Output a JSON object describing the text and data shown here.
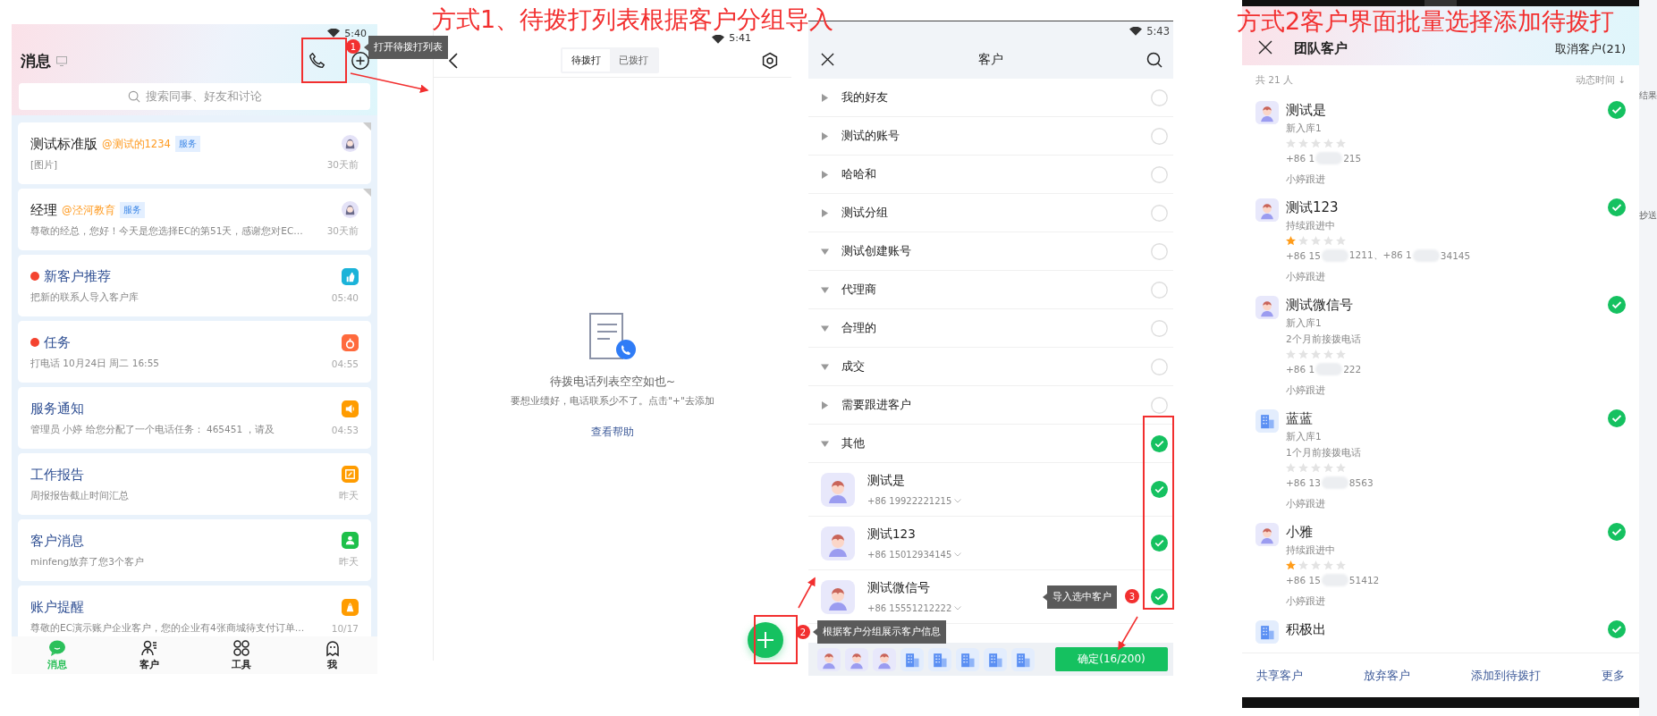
{
  "annotations": {
    "titles": [
      "方式1、待拨打列表根据客户分组导入",
      "方式2客户界面批量选择添加待拨打"
    ],
    "steps": [
      {
        "number": "1",
        "tip": "打开待拨打列表"
      },
      {
        "number": "2",
        "tip": "根据客户分组展示客户信息"
      },
      {
        "number": "3",
        "tip": "导入选中客户"
      }
    ]
  },
  "messages_screen": {
    "status_time": "5:40",
    "title": "消息",
    "search": {
      "placeholder": "搜索同事、好友和讨论"
    },
    "conversations": [
      {
        "kind": "chat",
        "title": "测试标准版",
        "mention": "@测试的1234",
        "tag": "服务",
        "preview": "[图片]",
        "time": "30天前",
        "unread": false,
        "pinned": true
      },
      {
        "kind": "chat",
        "title": "经理",
        "mention": "@泾河教育",
        "tag": "服务",
        "preview": "尊敬的经总，您好！今天是您选择EC的第51天，感谢您对EC…",
        "time": "30天前",
        "unread": false,
        "pinned": true
      },
      {
        "kind": "like",
        "color": "#1bb3d9",
        "title": "新客户推荐",
        "preview": "把新的联系人导入客户库",
        "time": "05:40",
        "unread": true,
        "pinned": false
      },
      {
        "kind": "fire",
        "color": "#ff6a3d",
        "title": "任务",
        "preview": "打电话 10月24日 周二 16:55",
        "time": "04:55",
        "unread": true,
        "pinned": false
      },
      {
        "kind": "speaker",
        "color": "#ff9c00",
        "title": "服务通知",
        "preview": "管理员 小婷 给您分配了一个电话任务：  465451 ，请及",
        "time": "04:53",
        "unread": false,
        "pinned": false
      },
      {
        "kind": "edit",
        "color": "#ff9c00",
        "title": "工作报告",
        "preview": "周报报告截止时间汇总",
        "time": "昨天",
        "unread": false,
        "pinned": false
      },
      {
        "kind": "user",
        "color": "#1ec04a",
        "title": "客户消息",
        "preview": "minfeng放弃了您3个客户",
        "time": "昨天",
        "unread": false,
        "pinned": false
      },
      {
        "kind": "bag",
        "color": "#ff9c00",
        "title": "账户提醒",
        "preview": "尊敬的EC演示账户企业客户，您的企业有4张商城待支付订单…",
        "time": "10/17",
        "unread": false,
        "pinned": false
      }
    ],
    "nav": [
      {
        "kind": "chat",
        "label": "消息",
        "selected": true
      },
      {
        "kind": "contacts",
        "label": "客户",
        "selected": false
      },
      {
        "kind": "apps",
        "label": "工具",
        "selected": false
      },
      {
        "kind": "ghost",
        "label": "我",
        "selected": false
      }
    ]
  },
  "call_list_screen": {
    "status_time": "5:41",
    "tabs": [
      {
        "label": "待拨打",
        "selected": true
      },
      {
        "label": "已拨打",
        "selected": false
      }
    ],
    "empty_title": "待拨电话列表空空如也~",
    "empty_hint": "要想业绩好，电话联系少不了。点击\"+\"去添加",
    "help_link": "查看帮助"
  },
  "customer_picker_screen": {
    "status_time": "5:43",
    "title": "客户",
    "groups": [
      {
        "name": "我的好友",
        "expanded": false,
        "checked": false
      },
      {
        "name": "测试的账号",
        "expanded": false,
        "checked": false
      },
      {
        "name": "哈哈和",
        "expanded": false,
        "checked": false
      },
      {
        "name": "测试分组",
        "expanded": false,
        "checked": false
      },
      {
        "name": "测试创建账号",
        "expanded": true,
        "checked": false
      },
      {
        "name": "代理商",
        "expanded": true,
        "checked": false
      },
      {
        "name": "合理的",
        "expanded": true,
        "checked": false
      },
      {
        "name": "成交",
        "expanded": true,
        "checked": false
      },
      {
        "name": "需要跟进客户",
        "expanded": false,
        "checked": false
      },
      {
        "name": "其他",
        "expanded": true,
        "checked": true,
        "children": [
          {
            "name": "测试是",
            "phone": "+86 19922221215",
            "checked": true
          },
          {
            "name": "测试123",
            "phone": "+86 15012934145",
            "checked": true
          },
          {
            "name": "测试微信号",
            "phone": "+86 15551212222",
            "checked": true
          }
        ]
      }
    ],
    "selected_avatars": [
      {
        "kind": "person"
      },
      {
        "kind": "person"
      },
      {
        "kind": "person"
      },
      {
        "kind": "company"
      },
      {
        "kind": "company"
      },
      {
        "kind": "company"
      },
      {
        "kind": "company"
      },
      {
        "kind": "company"
      }
    ],
    "confirm_button": "确定(16/200)"
  },
  "team_customers_screen": {
    "title": "团队客户",
    "cancel_button": "取消客户(21)",
    "count": "共 21 人",
    "sort_label": "动态时间 ↓",
    "customers": [
      {
        "kind": "person",
        "name": "测试是",
        "status": "新入库1",
        "stars": 0,
        "phone_parts": [
          "+86 1",
          "215"
        ],
        "owner": "小婷跟进",
        "checked": true
      },
      {
        "kind": "person",
        "name": "测试123",
        "status": "持续跟进中",
        "stars": 1,
        "phone_parts": [
          "+86 15",
          "1211、+86 1",
          "34145"
        ],
        "owner": "小婷跟进",
        "checked": true
      },
      {
        "kind": "person",
        "name": "测试微信号",
        "status": "新入库1",
        "last_call": "2个月前接拨电话",
        "stars": 0,
        "phone_parts": [
          "+86 1",
          "222"
        ],
        "owner": "小婷跟进",
        "checked": true
      },
      {
        "kind": "company",
        "name": "蓝蓝",
        "status": "新入库1",
        "last_call": "1个月前接拨电话",
        "stars": 0,
        "phone_parts": [
          "+86 13",
          "8563"
        ],
        "owner": "小婷跟进",
        "checked": true
      },
      {
        "kind": "person",
        "name": "小雅",
        "status": "持续跟进中",
        "stars": 1,
        "phone_parts": [
          "+86 15",
          "51412"
        ],
        "owner": "小婷跟进",
        "checked": true
      },
      {
        "kind": "company",
        "name": "积极出",
        "checked": true
      }
    ],
    "actions": [
      "共享客户",
      "放弃客户",
      "添加到待拨打",
      "更多"
    ],
    "edge_fragments": [
      "结果",
      "抄送"
    ]
  }
}
